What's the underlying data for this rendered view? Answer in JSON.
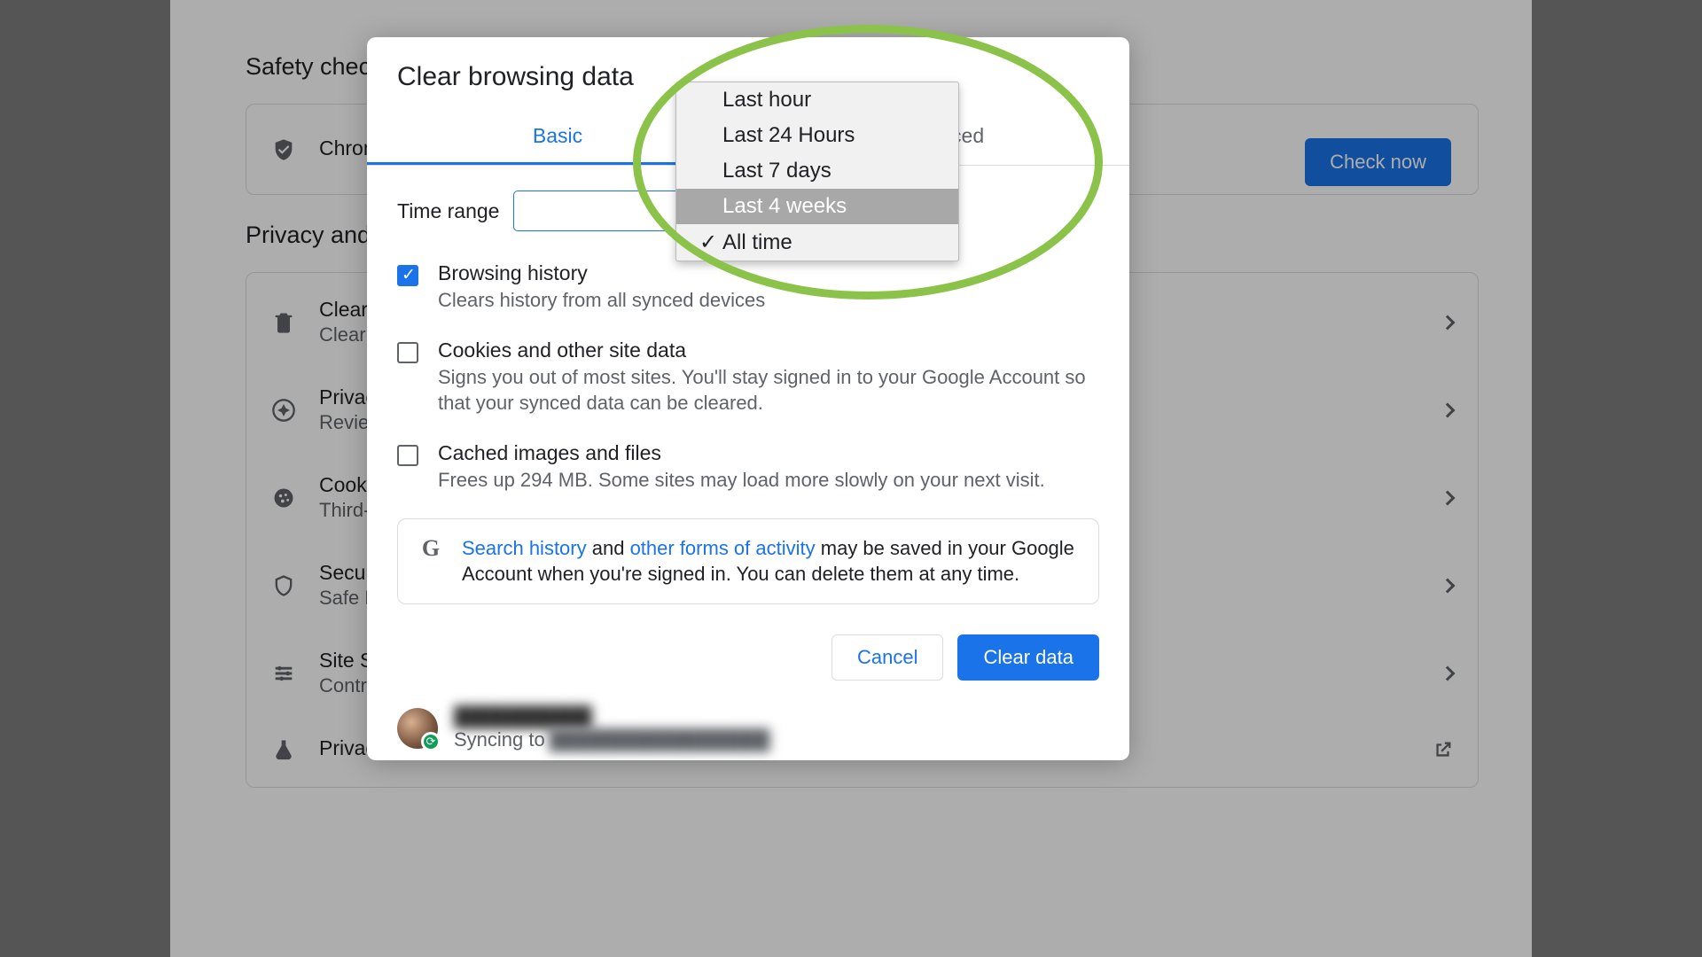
{
  "bg": {
    "safety_heading": "Safety check",
    "privacy_heading": "Privacy and security",
    "chrome_row": "Chrome",
    "check_now": "Check now",
    "rows": [
      {
        "primary": "Clear browsing data",
        "secondary": "Clear history, cookies, cache, and more"
      },
      {
        "primary": "Privacy Guide",
        "secondary": "Review key privacy and security controls"
      },
      {
        "primary": "Cookies and other site data",
        "secondary": "Third-party cookies are blocked in Incognito mode"
      },
      {
        "primary": "Security",
        "secondary": "Safe Browsing (protection from dangerous sites) and other security settings"
      },
      {
        "primary": "Site Settings",
        "secondary": "Controls what information sites can use and show"
      },
      {
        "primary": "Privacy Sandbox",
        "secondary": ""
      }
    ]
  },
  "modal": {
    "title": "Clear browsing data",
    "tabs": {
      "basic": "Basic",
      "advanced": "Advanced"
    },
    "time_label": "Time range",
    "options": {
      "browsing": {
        "title": "Browsing history",
        "desc": "Clears history from all synced devices",
        "checked": true
      },
      "cookies": {
        "title": "Cookies and other site data",
        "desc": "Signs you out of most sites. You'll stay signed in to your Google Account so that your synced data can be cleared.",
        "checked": false
      },
      "cache": {
        "title": "Cached images and files",
        "desc": "Frees up 294 MB. Some sites may load more slowly on your next visit.",
        "checked": false
      }
    },
    "info_text_1": "Search history",
    "info_text_2": " and ",
    "info_text_3": "other forms of activity",
    "info_text_4": " may be saved in your Google Account when you're signed in. You can delete them at any time.",
    "cancel": "Cancel",
    "clear": "Clear data",
    "sync_label": "Syncing to"
  },
  "dropdown": {
    "items": [
      "Last hour",
      "Last 24 Hours",
      "Last 7 days",
      "Last 4 weeks",
      "All time"
    ],
    "highlighted_index": 3,
    "checked_index": 4
  }
}
